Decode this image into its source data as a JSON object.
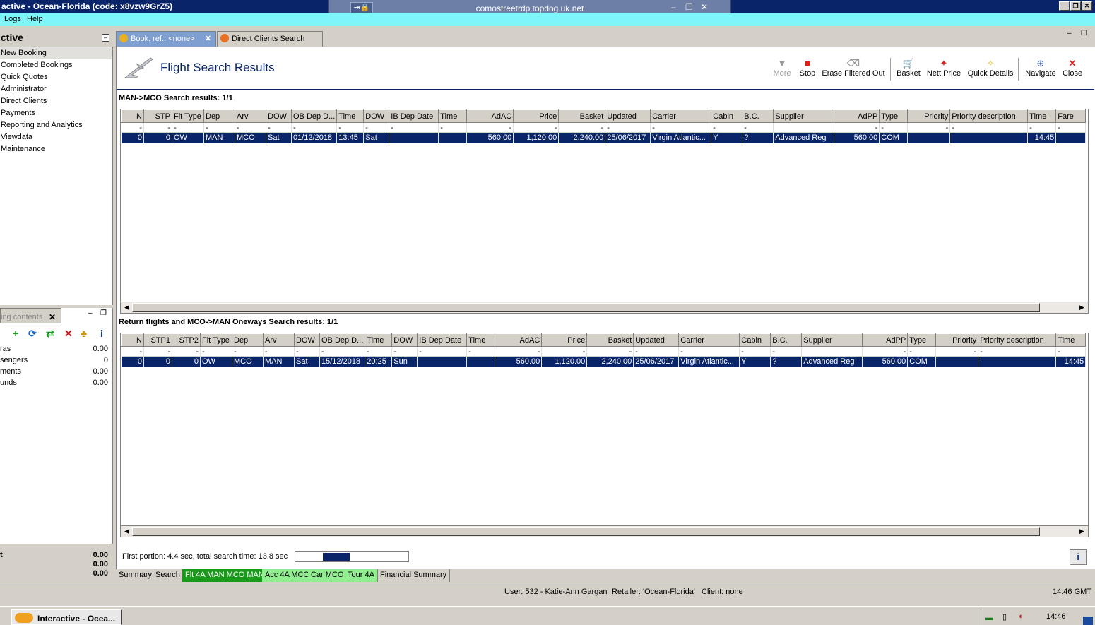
{
  "window": {
    "title": "active - Ocean-Florida (code: x8vzw9GrZ5)",
    "rdp_host": "comostreetrdp.topdog.uk.net"
  },
  "menu": [
    "Logs",
    "Help"
  ],
  "left_panel": {
    "header": "ctive",
    "items": [
      "New Booking",
      "Completed Bookings",
      "Quick Quotes",
      "Administrator",
      "Direct Clients",
      "Payments",
      "Reporting and Analytics",
      "Viewdata",
      "Maintenance"
    ]
  },
  "booking_panel": {
    "tab_label": "ing contents",
    "rows": [
      {
        "label": "ras",
        "value": "0.00"
      },
      {
        "label": "sengers",
        "value": "0"
      },
      {
        "label": "ments",
        "value": "0.00"
      },
      {
        "label": "unds",
        "value": "0.00"
      }
    ],
    "totals": [
      {
        "label": "t",
        "value": "0.00"
      },
      {
        "label": "",
        "value": "0.00"
      },
      {
        "label": "",
        "value": "0.00"
      }
    ]
  },
  "tabs": [
    "Book. ref.: <none>",
    "Direct Clients Search"
  ],
  "header": {
    "title": "Flight Search Results"
  },
  "toolbar": [
    "More",
    "Stop",
    "Erase Filtered Out",
    "Basket",
    "Nett Price",
    "Quick Details",
    "Navigate",
    "Close"
  ],
  "outbound": {
    "title": "MAN->MCO Search results: 1/1",
    "columns": [
      "N",
      "STP",
      "Flt Type",
      "Dep",
      "Arv",
      "DOW",
      "OB Dep D...",
      "Time",
      "DOW",
      "IB Dep Date",
      "Time",
      "AdAC",
      "Price",
      "Basket",
      "Updated",
      "Carrier",
      "Cabin",
      "B.C.",
      "Supplier",
      "AdPP",
      "Type",
      "Priority",
      "Priority description",
      "Time",
      "Fare"
    ],
    "filters": [
      "-",
      "-",
      "-",
      "-",
      "-",
      "-",
      "-",
      "-",
      "-",
      "-",
      "-",
      "-",
      "-",
      "-",
      "-",
      "-",
      "-",
      "-",
      "",
      "-",
      "-",
      "-",
      "-",
      "-",
      "-"
    ],
    "rows": [
      [
        "0",
        "0",
        "OW",
        "MAN",
        "MCO",
        "Sat",
        "01/12/2018",
        "13:45",
        "Sat",
        "",
        "",
        "560.00",
        "1,120.00",
        "2,240.00",
        "25/06/2017",
        "Virgin Atlantic...",
        "Y",
        "?",
        "Advanced Reg",
        "560.00",
        "COM",
        "",
        "",
        "14:45",
        ""
      ]
    ]
  },
  "return": {
    "title": "Return flights and MCO->MAN Oneways Search results: 1/1",
    "columns": [
      "N",
      "STP1",
      "STP2",
      "Flt Type",
      "Dep",
      "Arv",
      "DOW",
      "OB Dep D...",
      "Time",
      "DOW",
      "IB Dep Date",
      "Time",
      "AdAC",
      "Price",
      "Basket",
      "Updated",
      "Carrier",
      "Cabin",
      "B.C.",
      "Supplier",
      "AdPP",
      "Type",
      "Priority",
      "Priority description",
      "Time"
    ],
    "filters": [
      "-",
      "-",
      "-",
      "-",
      "-",
      "-",
      "-",
      "-",
      "-",
      "-",
      "-",
      "-",
      "-",
      "-",
      "-",
      "-",
      "-",
      "-",
      "-",
      "",
      "-",
      "-",
      "-",
      "-",
      "-"
    ],
    "rows": [
      [
        "0",
        "0",
        "0",
        "OW",
        "MCO",
        "MAN",
        "Sat",
        "15/12/2018",
        "20:25",
        "Sun",
        "",
        "",
        "560.00",
        "1,120.00",
        "2,240.00",
        "25/06/2017",
        "Virgin Atlantic...",
        "Y",
        "?",
        "Advanced Reg",
        "560.00",
        "COM",
        "",
        "",
        "14:45"
      ]
    ]
  },
  "status": {
    "timing": "First portion: 4.4 sec, total search time: 13.8 sec"
  },
  "bottom_tabs": [
    {
      "label": "Summary",
      "color": "#d4d0c8"
    },
    {
      "label": "Search",
      "color": "#d4d0c8"
    },
    {
      "label": "Flt 4A MAN MCO MAN",
      "color": "#1a9a1a"
    },
    {
      "label": "Acc 4A MCO",
      "color": "#90ee90"
    },
    {
      "label": "Car MCO",
      "color": "#90ee90"
    },
    {
      "label": "Tour 4A",
      "color": "#90ee90"
    },
    {
      "label": "Financial Summary",
      "color": "#d4d0c8"
    }
  ],
  "statusbar": {
    "user": "User: 532 - Katie-Ann Gargan",
    "retailer": "Retailer: 'Ocean-Florida'",
    "client": "Client: none",
    "time": "14:46 GMT"
  },
  "taskbar": {
    "app": "Interactive - Ocea...",
    "clock": "14:46"
  }
}
